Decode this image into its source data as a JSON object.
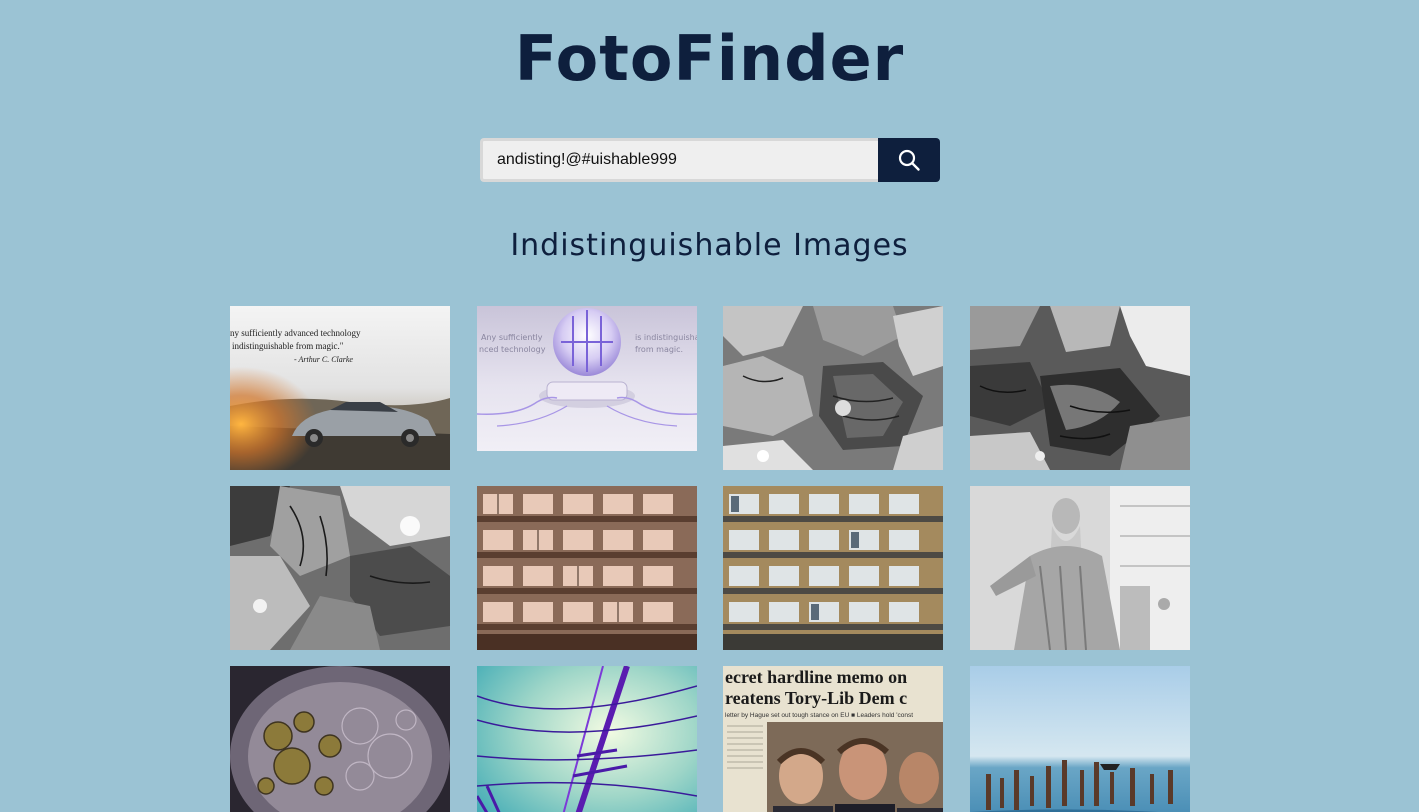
{
  "app": {
    "title": "FotoFinder"
  },
  "search": {
    "value": "andisting!@#uishable999",
    "button_icon": "search-icon"
  },
  "results": {
    "heading": "Indistinguishable Images",
    "tiles": [
      {
        "name": "car-quote-photo",
        "lines": [
          "ny sufficiently advanced technology",
          "indistinguishable from magic.\"",
          "- Arthur C. Clarke"
        ]
      },
      {
        "name": "glowing-sphere-photo",
        "lines": [
          "Any sufficiently",
          "nced technology",
          "is indistinguisha",
          "from magic."
        ]
      },
      {
        "name": "rocks-bw-photo-1"
      },
      {
        "name": "rocks-bw-photo-2"
      },
      {
        "name": "rocks-bw-photo-3"
      },
      {
        "name": "apartment-sepia-photo"
      },
      {
        "name": "apartment-color-photo"
      },
      {
        "name": "statue-bw-photo"
      },
      {
        "name": "oil-bubbles-photo"
      },
      {
        "name": "power-lines-photo"
      },
      {
        "name": "newspaper-photo",
        "lines": [
          "ecret hardline memo on",
          "reatens Tory-Lib Dem c",
          "letter by Hague set out tough stance on EU  ■ Leaders hold 'const"
        ]
      },
      {
        "name": "pier-sea-photo"
      }
    ]
  },
  "colors": {
    "background": "#9bc3d4",
    "accent": "#0e1f3d"
  }
}
